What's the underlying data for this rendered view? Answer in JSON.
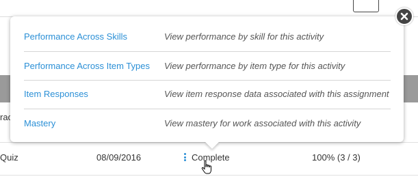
{
  "menu": {
    "items": [
      {
        "label": "Performance Across Skills",
        "description": "View performance by skill for this activity"
      },
      {
        "label": "Performance Across Item Types",
        "description": "View performance by item type for this activity"
      },
      {
        "label": "Item Responses",
        "description": "View item response data associated with this assignment"
      },
      {
        "label": "Mastery",
        "description": "View mastery for work associated with this activity"
      }
    ]
  },
  "background": {
    "partial_text": "rac",
    "row": {
      "type": "Quiz",
      "date": "08/09/2016",
      "status": "Complete",
      "score": "100% (3 / 3)"
    }
  },
  "icons": {
    "close": "close-icon",
    "more": "vertical-dots-icon",
    "cursor": "hand-pointer-icon"
  },
  "colors": {
    "link": "#2a8fd6",
    "close_bg": "#444444"
  }
}
